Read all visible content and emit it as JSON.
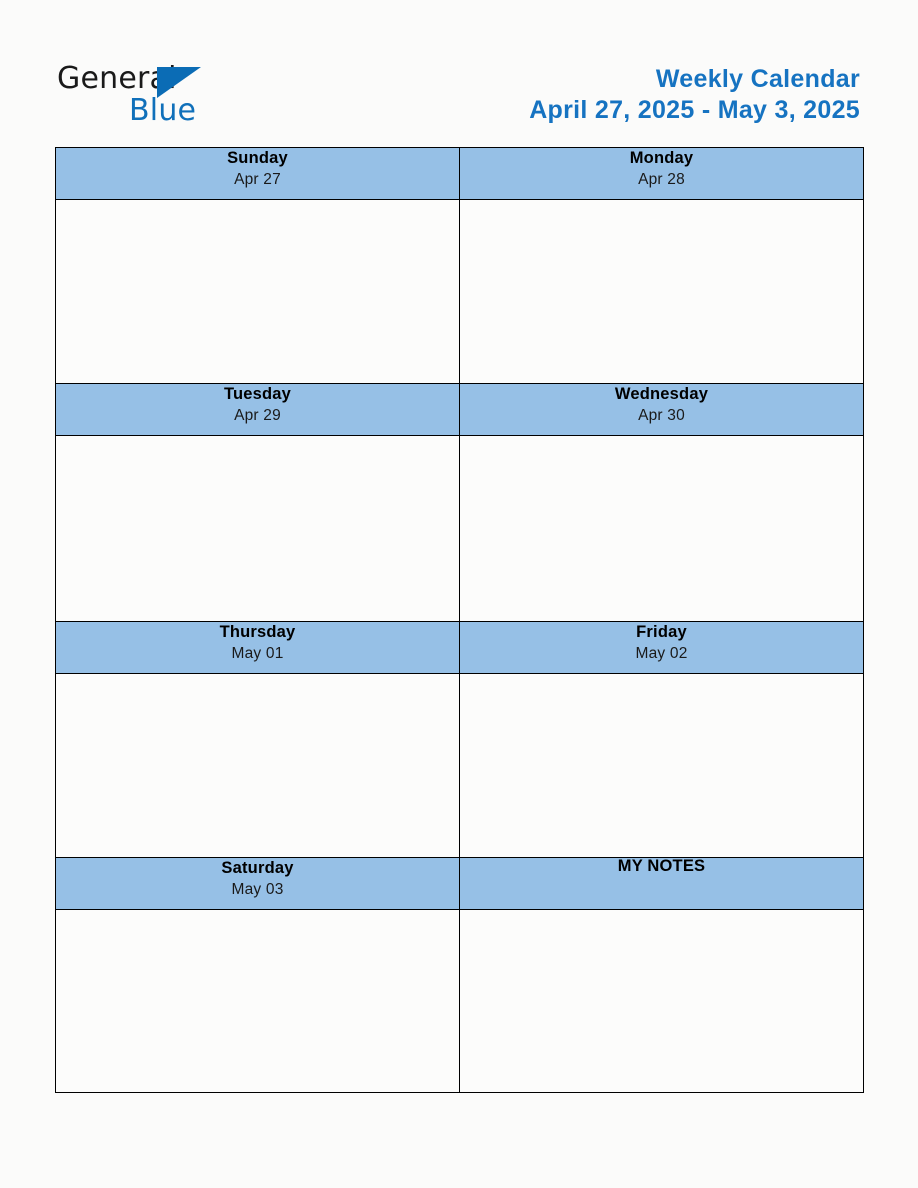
{
  "brand": {
    "name_part1": "General",
    "name_part2": "Blue",
    "triangle_color": "#0b6cb5",
    "blue_color": "#1070ba"
  },
  "header": {
    "title": "Weekly Calendar",
    "date_range": "April 27, 2025 - May 3, 2025",
    "title_color": "#1673c1"
  },
  "theme": {
    "header_cell_background": "#96c0e6",
    "page_background": "#fbfbfa",
    "border_color": "#000000"
  },
  "calendar": {
    "rows": [
      {
        "left": {
          "day": "Sunday",
          "date": "Apr 27",
          "notes_cell": false
        },
        "right": {
          "day": "Monday",
          "date": "Apr 28",
          "notes_cell": false
        }
      },
      {
        "left": {
          "day": "Tuesday",
          "date": "Apr 29",
          "notes_cell": false
        },
        "right": {
          "day": "Wednesday",
          "date": "Apr 30",
          "notes_cell": false
        }
      },
      {
        "left": {
          "day": "Thursday",
          "date": "May 01",
          "notes_cell": false
        },
        "right": {
          "day": "Friday",
          "date": "May 02",
          "notes_cell": false
        }
      },
      {
        "left": {
          "day": "Saturday",
          "date": "May 03",
          "notes_cell": false
        },
        "right": {
          "day": "MY NOTES",
          "date": "",
          "notes_cell": true
        }
      }
    ]
  }
}
